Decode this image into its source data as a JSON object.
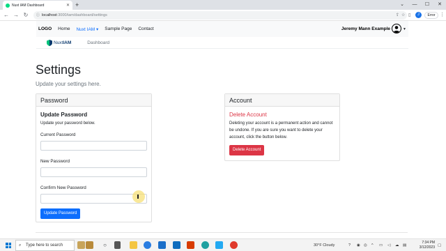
{
  "browser": {
    "tab_title": "Nuxt IAM Dashboard",
    "url_host": "localhost",
    "url_path": ":3000/iam/dashboard/settings",
    "error_button": "Error",
    "profile_initial": "J"
  },
  "navbar": {
    "brand": "LOGO",
    "links": [
      "Home",
      "Nuxt IAM ▾",
      "Sample Page",
      "Contact"
    ],
    "user_name": "Jeremy Mann Example"
  },
  "subnav": {
    "logo_text_a": "Nuxt",
    "logo_text_b": "IAM",
    "dashboard_link": "Dashboard"
  },
  "page": {
    "title": "Settings",
    "subtitle": "Update your settings here."
  },
  "password_card": {
    "header": "Password",
    "section_title": "Update Password",
    "description": "Update your password below.",
    "current_label": "Current Password",
    "new_label": "New Password",
    "confirm_label": "Confirm New Password",
    "current_value": "",
    "new_value": "",
    "confirm_value": "",
    "submit_label": "Update Password"
  },
  "account_card": {
    "header": "Account",
    "section_title": "Delete Account",
    "description": "Deleting your account is a permanent action and cannot be undone. If you are sure you want to delete your account, click the button below.",
    "delete_label": "Delete Account"
  },
  "taskbar": {
    "search_placeholder": "Type here to search",
    "weather": "30°F  Cloudy",
    "time": "7:34 PM",
    "date": "3/12/2023"
  },
  "colors": {
    "primary": "#0d6efd",
    "danger": "#dc3545",
    "nuxt_green": "#00dc82"
  }
}
